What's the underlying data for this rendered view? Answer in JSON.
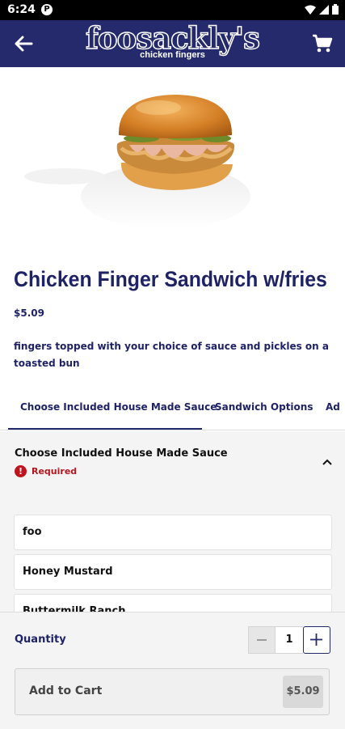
{
  "status_bar": {
    "time": "6:24",
    "app_icon": "P"
  },
  "header": {
    "logo_main": "foosackly's",
    "logo_sub": "chicken fingers",
    "back_icon": "arrow-left",
    "cart_icon": "shopping-cart"
  },
  "product": {
    "title": "Chicken Finger Sandwich w/fries",
    "price": "$5.09",
    "description": "fingers topped with your choice of sauce and pickles on a toasted bun"
  },
  "tabs": [
    {
      "label": "Choose Included House Made Sauce",
      "active": true
    },
    {
      "label": "Sandwich Options",
      "active": false
    },
    {
      "label": "Ad",
      "active": false
    }
  ],
  "section": {
    "title": "Choose Included House Made Sauce",
    "required_label": "Required",
    "options": [
      "foo",
      "Honey Mustard",
      "Buttermilk Ranch"
    ]
  },
  "footer": {
    "quantity_label": "Quantity",
    "quantity_value": "1",
    "add_to_cart_label": "Add to Cart",
    "add_to_cart_price": "$5.09"
  },
  "colors": {
    "brand_navy": "#242a6b",
    "required_red": "#c0141c"
  }
}
